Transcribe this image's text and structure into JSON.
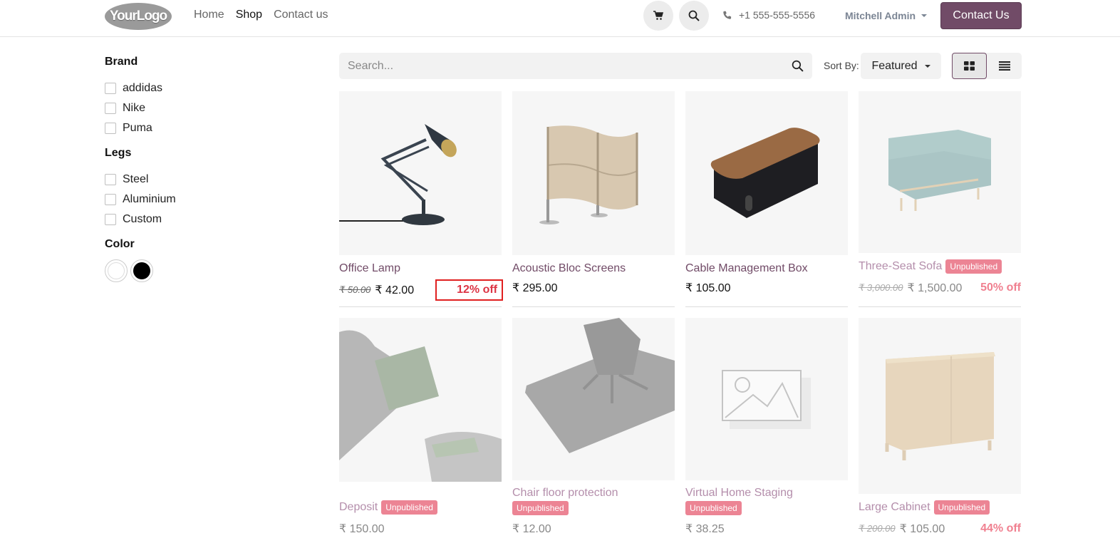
{
  "header": {
    "logo_text": "YourLogo",
    "nav": [
      "Home",
      "Shop",
      "Contact us"
    ],
    "active_nav": "Shop",
    "phone": "+1 555-555-5556",
    "user": "Mitchell Admin",
    "contact_button": "Contact Us",
    "cart_icon": "cart-icon",
    "search_icon": "search-icon",
    "accent_color": "#714b67"
  },
  "sidebar": {
    "brand": {
      "title": "Brand",
      "options": [
        "addidas",
        "Nike",
        "Puma"
      ]
    },
    "legs": {
      "title": "Legs",
      "options": [
        "Steel",
        "Aluminium",
        "Custom"
      ]
    },
    "color": {
      "title": "Color",
      "swatches": [
        "#ffffff",
        "#000000"
      ]
    }
  },
  "toolbar": {
    "search_placeholder": "Search...",
    "sort_label": "Sort By:",
    "sort_value": "Featured",
    "views": [
      "grid-view-icon",
      "list-view-icon"
    ],
    "active_view": "grid"
  },
  "products": [
    {
      "name": "Office Lamp",
      "old_price": "₹ 50.00",
      "price": "₹ 42.00",
      "discount": "12% off",
      "unpublished": false
    },
    {
      "name": "Acoustic Bloc Screens",
      "old_price": "",
      "price": "₹ 295.00",
      "discount": "",
      "unpublished": false
    },
    {
      "name": "Cable Management Box",
      "old_price": "",
      "price": "₹ 105.00",
      "discount": "",
      "unpublished": false
    },
    {
      "name": "Three-Seat Sofa",
      "old_price": "₹ 3,000.00",
      "price": "₹ 1,500.00",
      "discount": "50% off",
      "unpublished": true
    },
    {
      "name": "Deposit",
      "old_price": "",
      "price": "₹ 150.00",
      "discount": "",
      "unpublished": true
    },
    {
      "name": "Chair floor protection",
      "old_price": "",
      "price": "₹ 12.00",
      "discount": "",
      "unpublished": true
    },
    {
      "name": "Virtual Home Staging",
      "old_price": "",
      "price": "₹ 38.25",
      "discount": "",
      "unpublished": true
    },
    {
      "name": "Large Cabinet",
      "old_price": "₹ 200.00",
      "price": "₹ 105.00",
      "discount": "44% off",
      "unpublished": true
    }
  ],
  "badge_label": "Unpublished"
}
